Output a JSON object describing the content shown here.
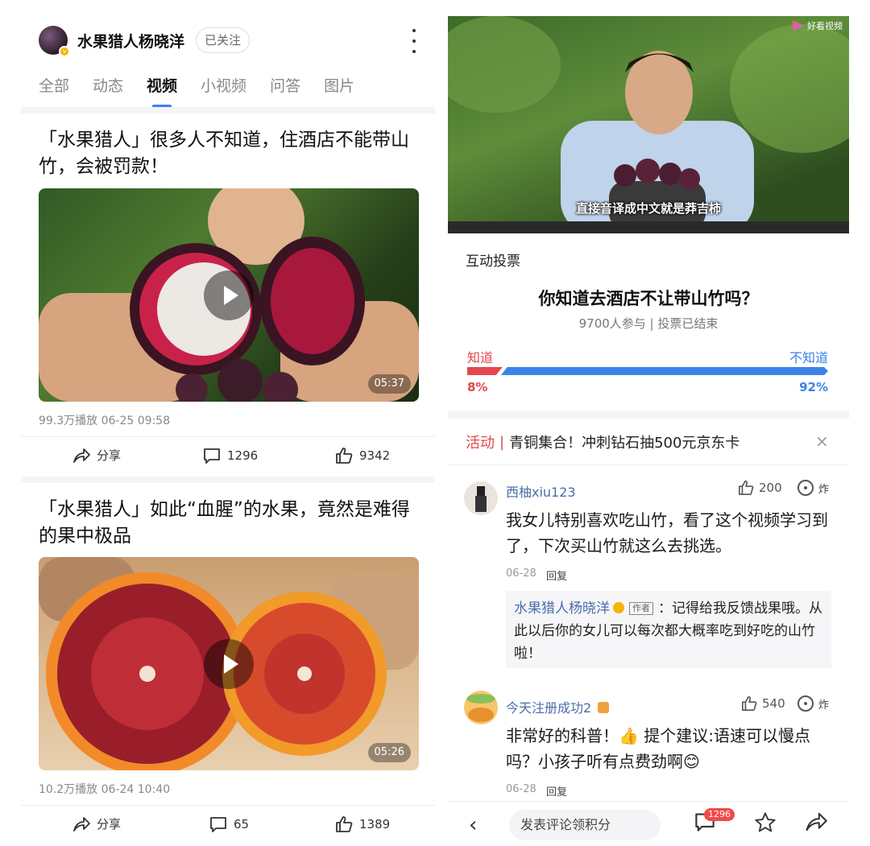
{
  "left": {
    "profile": {
      "name": "水果猎人杨晓洋",
      "follow_label": "已关注"
    },
    "tabs": [
      "全部",
      "动态",
      "视频",
      "小视频",
      "问答",
      "图片"
    ],
    "active_tab": "视频",
    "posts": [
      {
        "title": "「水果猎人」很多人不知道，住酒店不能带山竹，会被罚款！",
        "duration": "05:37",
        "meta": "99.3万播放  06-25 09:58",
        "share_label": "分享",
        "comments": "1296",
        "likes": "9342"
      },
      {
        "title": "「水果猎人」如此“血腥”的水果，竟然是难得的果中极品",
        "duration": "05:26",
        "meta": "10.2万播放  06-24 10:40",
        "share_label": "分享",
        "comments": "65",
        "likes": "1389"
      }
    ]
  },
  "right": {
    "hero": {
      "caption": "直接音译成中文就是莽吉柿",
      "logo": "好看视频"
    },
    "vote": {
      "header": "互动投票",
      "question": "你知道去酒店不让带山竹吗？",
      "subtitle": "9700人参与 | 投票已结束",
      "option_left": "知道",
      "option_right": "不知道",
      "pct_left": "8%",
      "pct_right": "92%",
      "left_fraction": 0.08,
      "left_color": "#e4474f",
      "right_color": "#3a84e8"
    },
    "promo": {
      "tag": "活动",
      "text": "青铜集合！冲刺钻石抽500元京东卡",
      "close": "×"
    },
    "comments": [
      {
        "user": "西柚xiu123",
        "likes": "200",
        "bomb": "炸",
        "text": "我女儿特别喜欢吃山竹，看了这个视频学习到了，下次买山竹就这么去挑选。",
        "date": "06-28",
        "reply_label": "回复",
        "author_reply": {
          "user": "水果猎人杨晓洋",
          "tag": "作者",
          "text": "：记得给我反馈战果哦。从此以后你的女儿可以每次都大概率吃到好吃的山竹啦！"
        }
      },
      {
        "user": "今天注册成功2",
        "likes": "540",
        "bomb": "炸",
        "text": "非常好的科普！👍 提个建议:语速可以慢点吗？小孩子听有点费劲啊😊",
        "date": "06-28",
        "reply_label": "回复"
      }
    ],
    "bottom": {
      "placeholder": "发表评论领积分",
      "comment_badge": "1296"
    }
  }
}
